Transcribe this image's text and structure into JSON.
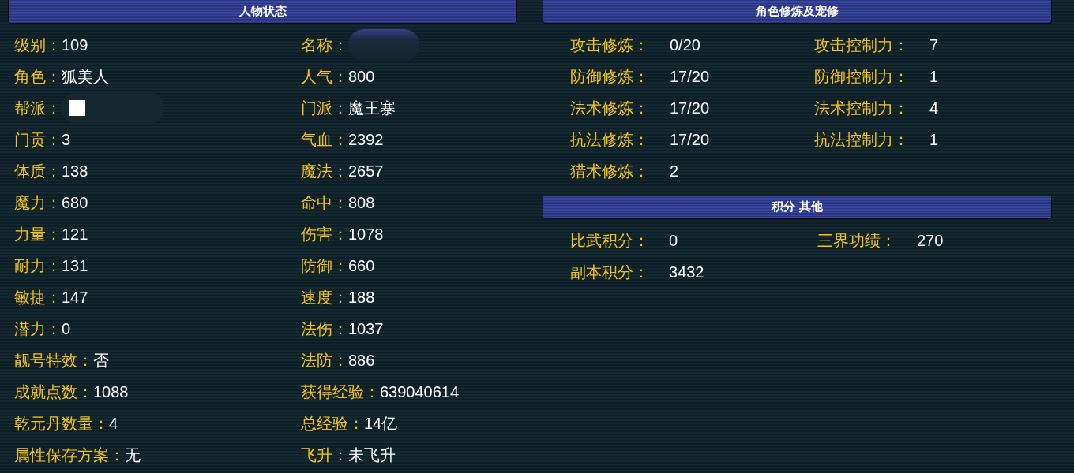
{
  "status": {
    "title": "人物状态",
    "items": [
      {
        "label": "级别：",
        "kind": "plain",
        "value": "109"
      },
      {
        "label": "名称：",
        "kind": "redacted"
      },
      {
        "label": "角色：",
        "kind": "plain",
        "value": "狐美人"
      },
      {
        "label": "人气：",
        "kind": "plain",
        "value": "800"
      },
      {
        "label": "帮派：",
        "kind": "redacted_mark"
      },
      {
        "label": "门派：",
        "kind": "plain",
        "value": "魔王寨"
      },
      {
        "label": "门贡：",
        "kind": "plain",
        "value": "3"
      },
      {
        "label": "气血：",
        "kind": "plain",
        "value": "2392"
      },
      {
        "label": "体质：",
        "kind": "plain",
        "value": "138"
      },
      {
        "label": "魔法：",
        "kind": "plain",
        "value": "2657"
      },
      {
        "label": "魔力：",
        "kind": "plain",
        "value": "680"
      },
      {
        "label": "命中：",
        "kind": "plain",
        "value": "808"
      },
      {
        "label": "力量：",
        "kind": "plain",
        "value": "121"
      },
      {
        "label": "伤害：",
        "kind": "plain",
        "value": "1078"
      },
      {
        "label": "耐力：",
        "kind": "plain",
        "value": "131"
      },
      {
        "label": "防御：",
        "kind": "plain",
        "value": "660"
      },
      {
        "label": "敏捷：",
        "kind": "plain",
        "value": "147"
      },
      {
        "label": "速度：",
        "kind": "plain",
        "value": "188"
      },
      {
        "label": "潜力：",
        "kind": "plain",
        "value": "0"
      },
      {
        "label": "法伤：",
        "kind": "plain",
        "value": "1037"
      },
      {
        "label": "靓号特效：",
        "kind": "plain",
        "value": "否"
      },
      {
        "label": "法防：",
        "kind": "plain",
        "value": "886"
      },
      {
        "label": "成就点数：",
        "kind": "plain",
        "value": "1088"
      },
      {
        "label": "获得经验：",
        "kind": "plain",
        "value": "639040614"
      },
      {
        "label": "乾元丹数量：",
        "kind": "plain",
        "value": "4"
      },
      {
        "label": "总经验：",
        "kind": "plain",
        "value": "14亿"
      },
      {
        "label": "属性保存方案：",
        "kind": "plain",
        "value": "无"
      },
      {
        "label": "飞升：",
        "kind": "plain",
        "value": "未飞升"
      }
    ]
  },
  "sections": [
    {
      "title": "角色修炼及宠修",
      "kind": "cultivation",
      "items": [
        {
          "label": "攻击修炼：",
          "value": "0/20"
        },
        {
          "label": "攻击控制力：",
          "value": "7"
        },
        {
          "label": "防御修炼：",
          "value": "17/20"
        },
        {
          "label": "防御控制力：",
          "value": "1"
        },
        {
          "label": "法术修炼：",
          "value": "17/20"
        },
        {
          "label": "法术控制力：",
          "value": "4"
        },
        {
          "label": "抗法修炼：",
          "value": "17/20"
        },
        {
          "label": "抗法控制力：",
          "value": "1"
        },
        {
          "label": "猎术修炼：",
          "value": "2"
        }
      ]
    },
    {
      "title": "积分 其他",
      "kind": "scores",
      "items": [
        {
          "label": "比武积分：",
          "value": "0"
        },
        {
          "label": "三界功绩：",
          "value": "270"
        },
        {
          "label": "副本积分：",
          "value": "3432"
        }
      ]
    }
  ]
}
